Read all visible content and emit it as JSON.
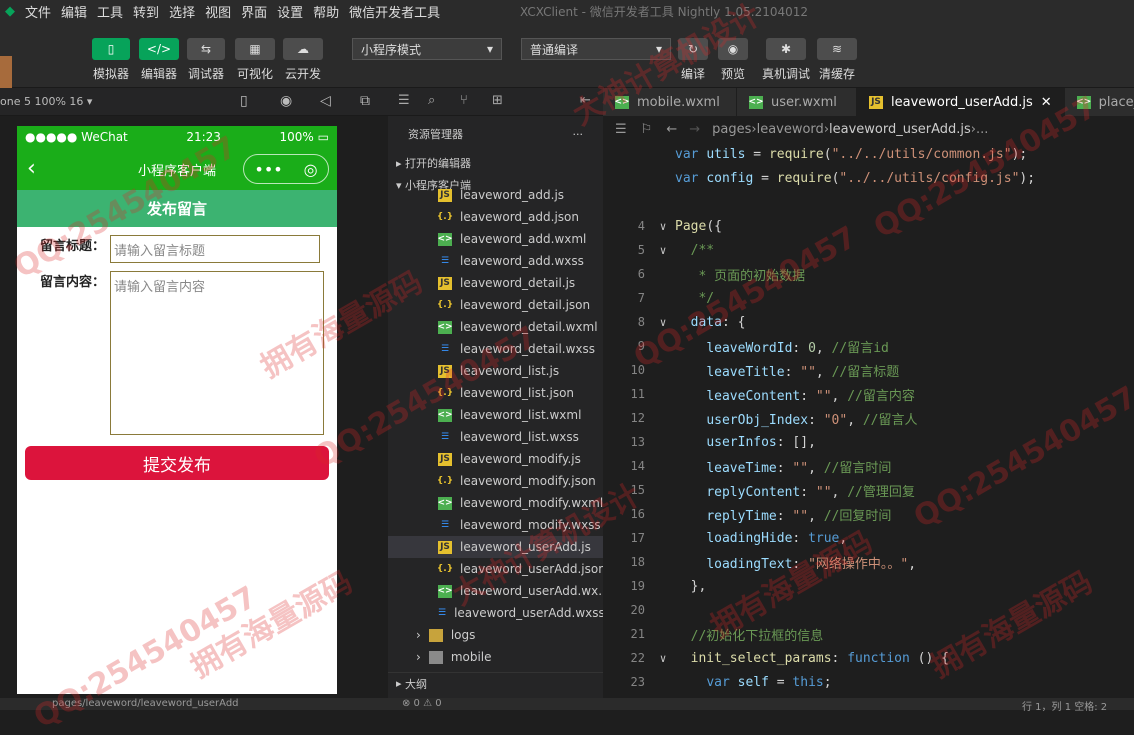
{
  "menubar": {
    "items": [
      "文件",
      "编辑",
      "工具",
      "转到",
      "选择",
      "视图",
      "界面",
      "设置",
      "帮助",
      "微信开发者工具"
    ],
    "window_title": "XCXClient - 微信开发者工具 Nightly 1.05.2104012"
  },
  "toolbar": {
    "left_buttons": [
      {
        "label": "模拟器",
        "icon": "phone-icon"
      },
      {
        "label": "编辑器",
        "icon": "code-icon"
      },
      {
        "label": "调试器",
        "icon": "debug-icon"
      },
      {
        "label": "可视化",
        "icon": "layout-icon"
      },
      {
        "label": "云开发",
        "icon": "cloud-icon"
      }
    ],
    "mode_select": "小程序模式",
    "compile_select": "普通编译",
    "right_buttons": [
      {
        "label": "编译",
        "icon": "refresh-icon"
      },
      {
        "label": "预览",
        "icon": "eye-icon"
      },
      {
        "label": "真机调试",
        "icon": "bug-icon"
      },
      {
        "label": "清缓存",
        "icon": "layers-icon"
      }
    ]
  },
  "simulator": {
    "device": "one 5 100% 16 ▾",
    "status_left": "●●●●● WeChat",
    "status_time": "21:23",
    "status_battery": "100%",
    "nav_title": "小程序客户端",
    "page_header": "发布留言",
    "title_label": "留言标题：",
    "title_placeholder": "请输入留言标题",
    "content_label": "留言内容：",
    "content_placeholder": "请输入留言内容",
    "submit_label": "提交发布"
  },
  "explorer": {
    "header": "资源管理器",
    "open_editors": "打开的编辑器",
    "project": "小程序客户端",
    "outline": "大纲",
    "files": [
      {
        "name": "leaveword_add.js",
        "type": "js"
      },
      {
        "name": "leaveword_add.json",
        "type": "json"
      },
      {
        "name": "leaveword_add.wxml",
        "type": "wxml"
      },
      {
        "name": "leaveword_add.wxss",
        "type": "wxss"
      },
      {
        "name": "leaveword_detail.js",
        "type": "js"
      },
      {
        "name": "leaveword_detail.json",
        "type": "json"
      },
      {
        "name": "leaveword_detail.wxml",
        "type": "wxml"
      },
      {
        "name": "leaveword_detail.wxss",
        "type": "wxss"
      },
      {
        "name": "leaveword_list.js",
        "type": "js"
      },
      {
        "name": "leaveword_list.json",
        "type": "json"
      },
      {
        "name": "leaveword_list.wxml",
        "type": "wxml"
      },
      {
        "name": "leaveword_list.wxss",
        "type": "wxss"
      },
      {
        "name": "leaveword_modify.js",
        "type": "js"
      },
      {
        "name": "leaveword_modify.json",
        "type": "json"
      },
      {
        "name": "leaveword_modify.wxml",
        "type": "wxml"
      },
      {
        "name": "leaveword_modify.wxss",
        "type": "wxss"
      },
      {
        "name": "leaveword_userAdd.js",
        "type": "js",
        "selected": true
      },
      {
        "name": "leaveword_userAdd.json",
        "type": "json"
      },
      {
        "name": "leaveword_userAdd.wx...",
        "type": "wxml"
      },
      {
        "name": "leaveword_userAdd.wxss",
        "type": "wxss"
      }
    ],
    "folders": [
      "logs",
      "mobile"
    ]
  },
  "tabs": [
    {
      "label": "mobile.wxml",
      "type": "wxml"
    },
    {
      "label": "user.wxml",
      "type": "wxml"
    },
    {
      "label": "leaveword_userAdd.js",
      "type": "js",
      "active": true
    },
    {
      "label": "place_list.w",
      "type": "wxml"
    }
  ],
  "breadcrumbs": [
    "pages",
    "leaveword",
    "leaveword_userAdd.js",
    "..."
  ],
  "code_lines": [
    {
      "n": "",
      "html": "<span class=\"kw\">var</span> <span class=\"prop\">utils</span> = <span class=\"fn\">require</span>(<span class=\"str\">\"../../utils/common.js\"</span>);"
    },
    {
      "n": "",
      "html": "<span class=\"kw\">var</span> <span class=\"prop\">config</span> = <span class=\"fn\">require</span>(<span class=\"str\">\"../../utils/config.js\"</span>);"
    },
    {
      "n": "",
      "html": ""
    },
    {
      "n": "4",
      "fold": "∨",
      "html": "<span class=\"fn\">Page</span>({"
    },
    {
      "n": "5",
      "fold": "∨",
      "html": "  <span class=\"cm\">/**</span>"
    },
    {
      "n": "6",
      "html": "   <span class=\"cm\">* 页面的初始数据</span>"
    },
    {
      "n": "7",
      "html": "   <span class=\"cm\">*/</span>"
    },
    {
      "n": "8",
      "fold": "∨",
      "html": "  <span class=\"prop\">data</span>: {"
    },
    {
      "n": "9",
      "html": "    <span class=\"prop\">leaveWordId</span>: <span class=\"num\">0</span>, <span class=\"cm\">//留言id</span>"
    },
    {
      "n": "10",
      "html": "    <span class=\"prop\">leaveTitle</span>: <span class=\"str\">\"\"</span>, <span class=\"cm\">//留言标题</span>"
    },
    {
      "n": "11",
      "html": "    <span class=\"prop\">leaveContent</span>: <span class=\"str\">\"\"</span>, <span class=\"cm\">//留言内容</span>"
    },
    {
      "n": "12",
      "html": "    <span class=\"prop\">userObj_Index</span>: <span class=\"str\">\"0\"</span>, <span class=\"cm\">//留言人</span>"
    },
    {
      "n": "13",
      "html": "    <span class=\"prop\">userInfos</span>: [],"
    },
    {
      "n": "14",
      "html": "    <span class=\"prop\">leaveTime</span>: <span class=\"str\">\"\"</span>, <span class=\"cm\">//留言时间</span>"
    },
    {
      "n": "15",
      "html": "    <span class=\"prop\">replyContent</span>: <span class=\"str\">\"\"</span>, <span class=\"cm\">//管理回复</span>"
    },
    {
      "n": "16",
      "html": "    <span class=\"prop\">replyTime</span>: <span class=\"str\">\"\"</span>, <span class=\"cm\">//回复时间</span>"
    },
    {
      "n": "17",
      "html": "    <span class=\"prop\">loadingHide</span>: <span class=\"kw\">true</span>,"
    },
    {
      "n": "18",
      "html": "    <span class=\"prop\">loadingText</span>: <span class=\"str\">\"网络操作中。。\"</span>,"
    },
    {
      "n": "19",
      "html": "  },"
    },
    {
      "n": "20",
      "html": ""
    },
    {
      "n": "21",
      "html": "  <span class=\"cm\">//初始化下拉框的信息</span>"
    },
    {
      "n": "22",
      "fold": "∨",
      "html": "  <span class=\"fn\">init_select_params</span>: <span class=\"kw\">function</span> () {"
    },
    {
      "n": "23",
      "html": "    <span class=\"kw\">var</span> <span class=\"prop\">self</span> = <span class=\"kw\">this</span>;"
    }
  ],
  "statusbar": {
    "path": "pages/leaveword/leaveword_userAdd",
    "problems": "⊗ 0 ⚠ 0",
    "position": "行 1，列 1   空格: 2"
  },
  "watermarks": [
    "QQ:254540457",
    "拥有海量源码",
    "大神计算机设计"
  ]
}
